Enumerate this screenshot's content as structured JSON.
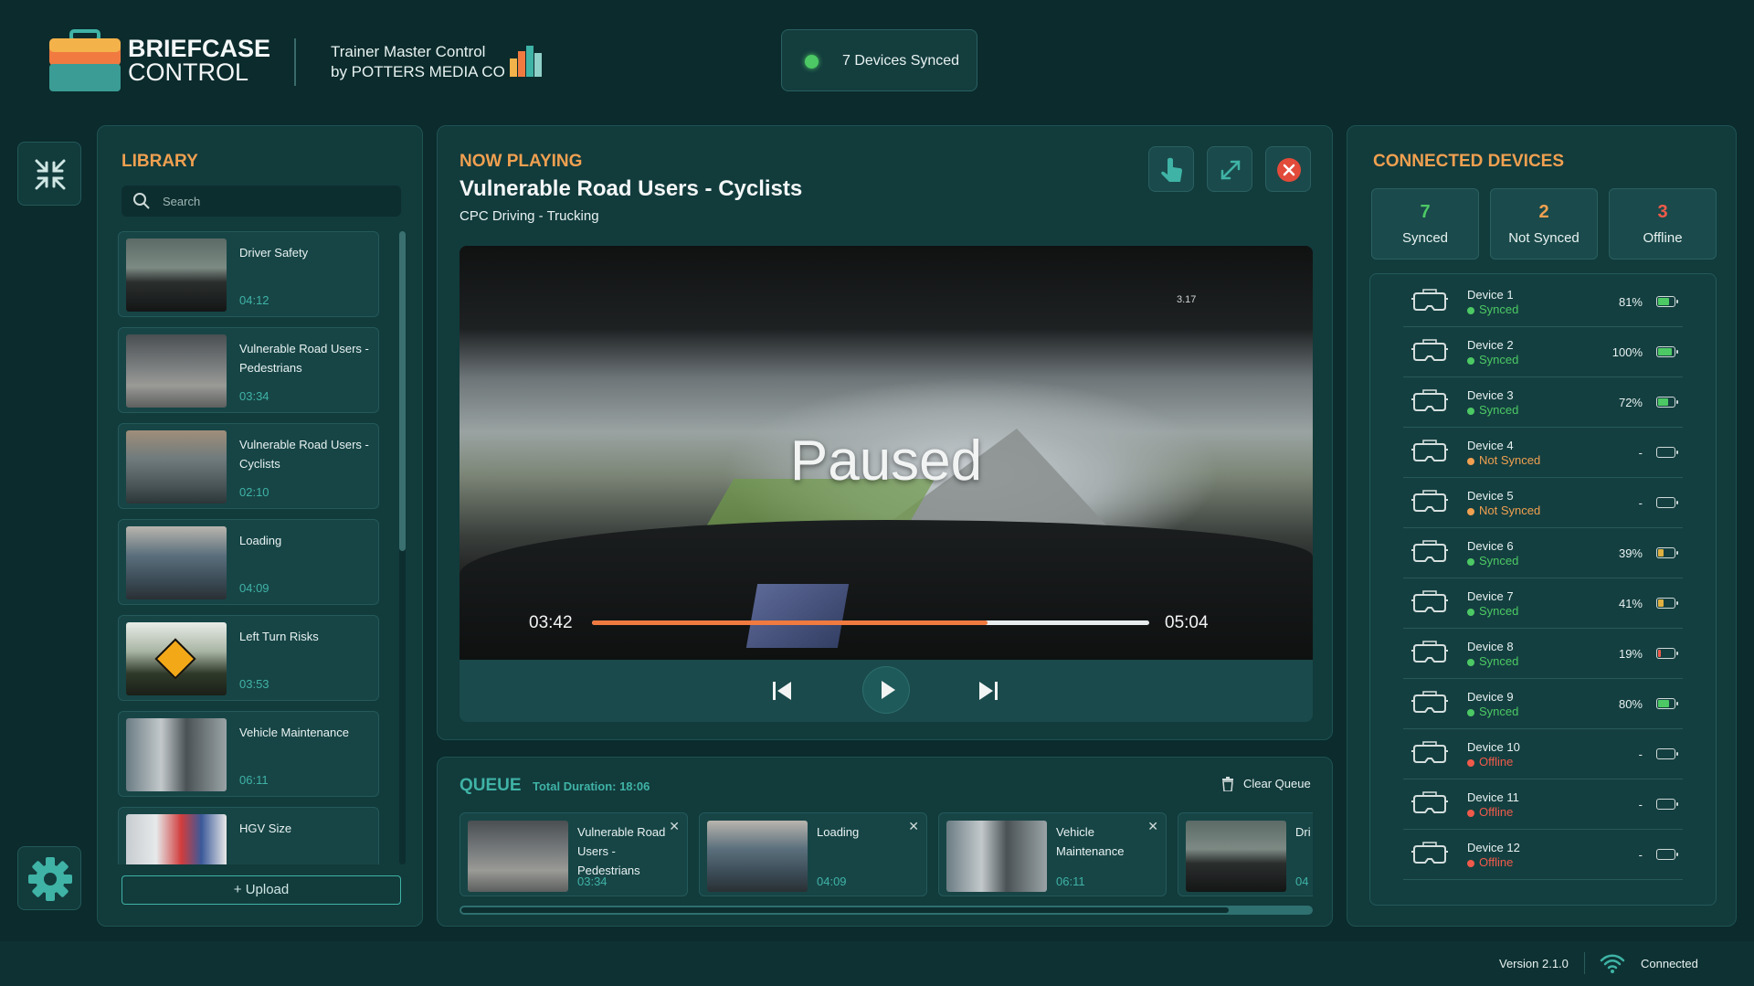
{
  "brand": {
    "line1": "BRIEFCASE",
    "line2": "CONTROL",
    "sub1": "Trainer Master Control",
    "sub2": "by POTTERS MEDIA CO"
  },
  "sync_badge": "7 Devices Synced",
  "library": {
    "title": "LIBRARY",
    "search_placeholder": "Search",
    "items": [
      {
        "title": "Driver Safety",
        "duration": "04:12"
      },
      {
        "title": "Vulnerable Road Users - Pedestrians",
        "duration": "03:34"
      },
      {
        "title": "Vulnerable Road Users - Cyclists",
        "duration": "02:10"
      },
      {
        "title": "Loading",
        "duration": "04:09"
      },
      {
        "title": "Left Turn Risks",
        "duration": "03:53"
      },
      {
        "title": "Vehicle Maintenance",
        "duration": "06:11"
      },
      {
        "title": "HGV Size",
        "duration": ""
      }
    ],
    "upload_label": "+ Upload"
  },
  "now_playing": {
    "label": "NOW PLAYING",
    "title": "Vulnerable Road Users - Cyclists",
    "subtitle": "CPC Driving - Trucking",
    "overlay": "Paused",
    "dash_readout": "3.17",
    "time_current": "03:42",
    "time_total": "05:04",
    "progress": 0.71
  },
  "queue": {
    "title": "QUEUE",
    "total": "Total Duration: 18:06",
    "clear_label": "Clear Queue",
    "items": [
      {
        "title": "Vulnerable Road Users - Pedestrians",
        "duration": "03:34"
      },
      {
        "title": "Loading",
        "duration": "04:09"
      },
      {
        "title": "Vehicle Maintenance",
        "duration": "06:11"
      },
      {
        "title": "Dri",
        "duration": "04"
      }
    ],
    "close_glyph": "✕"
  },
  "devices": {
    "title": "CONNECTED DEVICES",
    "counts": [
      {
        "num": "7",
        "label": "Synced",
        "color": "#4cc964"
      },
      {
        "num": "2",
        "label": "Not Synced",
        "color": "#f0a050"
      },
      {
        "num": "3",
        "label": "Offline",
        "color": "#f05a4a"
      }
    ],
    "list": [
      {
        "name": "Device 1",
        "status": "Synced",
        "pct": "81%",
        "level": 0.81,
        "color": "#4cc964"
      },
      {
        "name": "Device 2",
        "status": "Synced",
        "pct": "100%",
        "level": 1.0,
        "color": "#4cc964"
      },
      {
        "name": "Device 3",
        "status": "Synced",
        "pct": "72%",
        "level": 0.72,
        "color": "#4cc964"
      },
      {
        "name": "Device 4",
        "status": "Not Synced",
        "pct": "-",
        "level": 0,
        "color": "#f0a050"
      },
      {
        "name": "Device 5",
        "status": "Not Synced",
        "pct": "-",
        "level": 0,
        "color": "#f0a050"
      },
      {
        "name": "Device 6",
        "status": "Synced",
        "pct": "39%",
        "level": 0.39,
        "color": "#4cc964"
      },
      {
        "name": "Device 7",
        "status": "Synced",
        "pct": "41%",
        "level": 0.41,
        "color": "#4cc964"
      },
      {
        "name": "Device 8",
        "status": "Synced",
        "pct": "19%",
        "level": 0.19,
        "color": "#4cc964"
      },
      {
        "name": "Device 9",
        "status": "Synced",
        "pct": "80%",
        "level": 0.8,
        "color": "#4cc964"
      },
      {
        "name": "Device 10",
        "status": "Offline",
        "pct": "-",
        "level": 0,
        "color": "#f05a4a"
      },
      {
        "name": "Device 11",
        "status": "Offline",
        "pct": "-",
        "level": 0,
        "color": "#f05a4a"
      },
      {
        "name": "Device 12",
        "status": "Offline",
        "pct": "-",
        "level": 0,
        "color": "#f05a4a"
      }
    ]
  },
  "footer": {
    "version": "Version 2.1.0",
    "connection": "Connected"
  },
  "colors": {
    "accent": "#f0a050",
    "teal": "#3fb3a6",
    "synced": "#4cc964",
    "offline": "#f05a4a"
  }
}
